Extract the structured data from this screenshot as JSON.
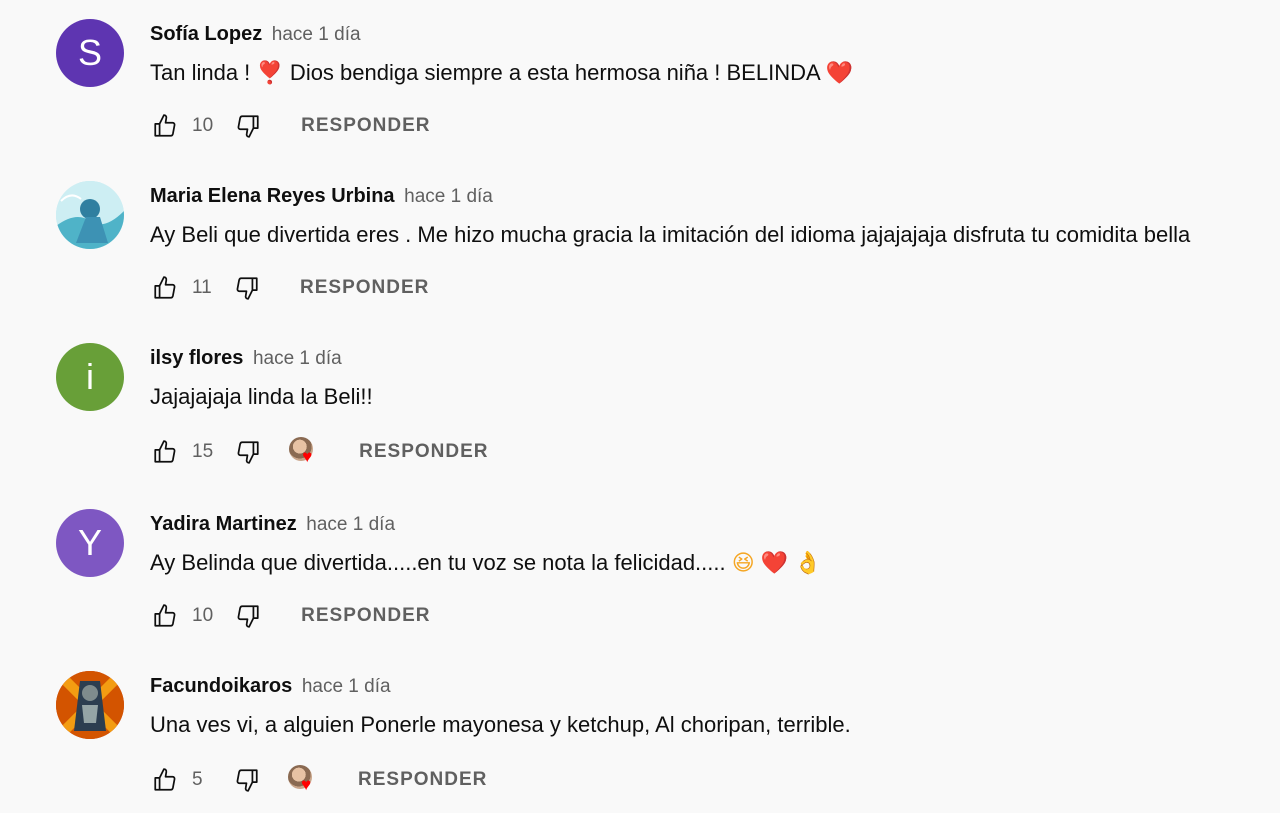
{
  "comments": [
    {
      "author": "Sofía Lopez",
      "time": "hace 1 día",
      "text_before": "Tan linda ! ",
      "emoji1": "❣️",
      "text_middle": " Dios bendiga siempre a esta hermosa niña ! BELINDA ",
      "emoji2": "❤️",
      "likes": "10",
      "reply_label": "RESPONDER",
      "avatar_letter": "S",
      "avatar_color": "#5e35b1"
    },
    {
      "author": "Maria Elena Reyes Urbina",
      "time": "hace 1 día",
      "text": "Ay Beli que divertida eres . Me hizo mucha gracia la imitación del idioma jajajajaja disfruta tu comidita bella",
      "likes": "11",
      "reply_label": "RESPONDER"
    },
    {
      "author": "ilsy flores",
      "time": "hace 1 día",
      "text": "Jajajajaja linda la Beli!!",
      "likes": "15",
      "reply_label": "RESPONDER",
      "avatar_letter": "i",
      "avatar_color": "#689f38",
      "creator_heart": true
    },
    {
      "author": "Yadira Martinez",
      "time": "hace 1 día",
      "text": "Ay Belinda que divertida.....en tu voz se nota la felicidad..... ",
      "emojis": [
        "😆",
        "❤️",
        "👌"
      ],
      "likes": "10",
      "reply_label": "RESPONDER",
      "avatar_letter": "Y",
      "avatar_color": "#7e57c2"
    },
    {
      "author": "Facundoikaros",
      "time": "hace 1 día",
      "text": "Una ves vi, a alguien Ponerle mayonesa y ketchup, Al choripan, terrible.",
      "likes": "5",
      "reply_label": "RESPONDER",
      "creator_heart": true
    }
  ]
}
